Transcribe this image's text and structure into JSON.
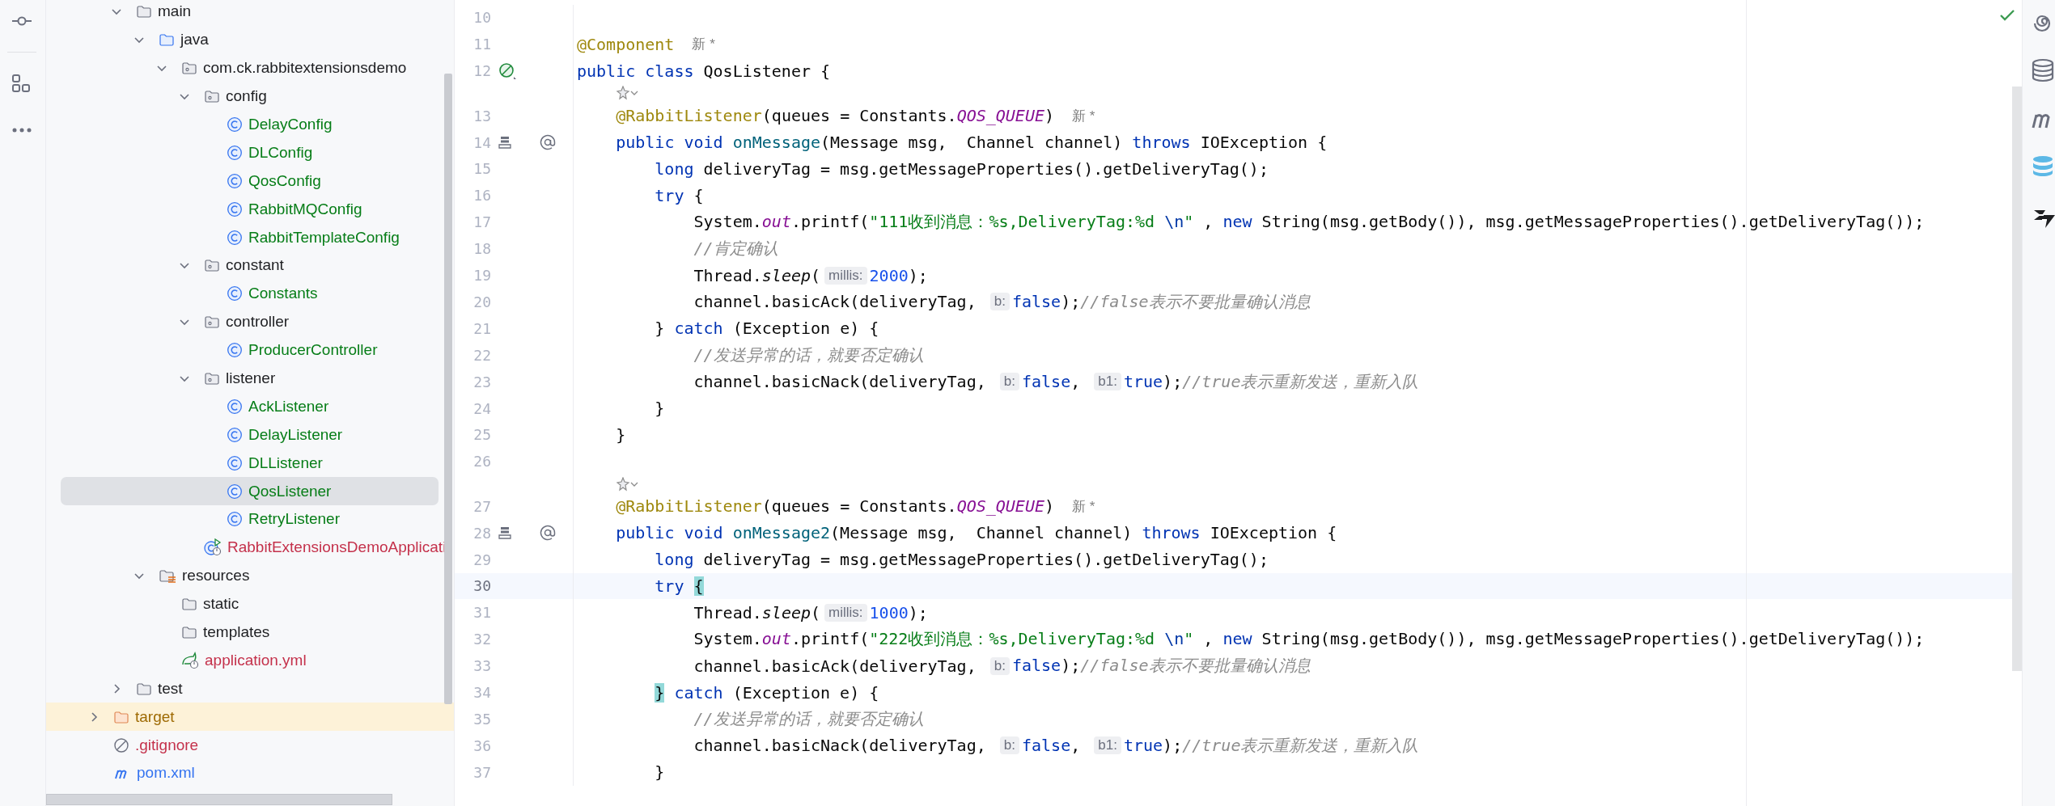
{
  "tree": {
    "items": [
      {
        "children": [
          {
            "label": "main",
            "kind": "folder",
            "expanded": true,
            "selected": false,
            "children": [
              {
                "label": "java",
                "kind": "source-folder",
                "expanded": true,
                "selected": false,
                "children": [
                  {
                    "label": "com.ck.rabbitextensionsdemo",
                    "kind": "package",
                    "expanded": true,
                    "selected": false,
                    "children": [
                      {
                        "label": "config",
                        "kind": "package",
                        "expanded": true,
                        "selected": false,
                        "children": [
                          {
                            "label": "DelayConfig",
                            "kind": "class",
                            "color": "#067d17",
                            "selected": false
                          },
                          {
                            "label": "DLConfig",
                            "kind": "class",
                            "color": "#067d17",
                            "selected": false
                          },
                          {
                            "label": "QosConfig",
                            "kind": "class",
                            "color": "#067d17",
                            "selected": false
                          },
                          {
                            "label": "RabbitMQConfig",
                            "kind": "class",
                            "color": "#067d17",
                            "selected": false
                          },
                          {
                            "label": "RabbitTemplateConfig",
                            "kind": "class",
                            "color": "#067d17",
                            "selected": false
                          }
                        ]
                      },
                      {
                        "label": "constant",
                        "kind": "package",
                        "expanded": true,
                        "selected": false,
                        "children": [
                          {
                            "label": "Constants",
                            "kind": "class",
                            "color": "#067d17",
                            "selected": false
                          }
                        ]
                      },
                      {
                        "label": "controller",
                        "kind": "package",
                        "expanded": true,
                        "selected": false,
                        "children": [
                          {
                            "label": "ProducerController",
                            "kind": "class",
                            "color": "#067d17",
                            "selected": false
                          }
                        ]
                      },
                      {
                        "label": "listener",
                        "kind": "package",
                        "expanded": true,
                        "selected": false,
                        "children": [
                          {
                            "label": "AckListener",
                            "kind": "class",
                            "color": "#067d17",
                            "selected": false
                          },
                          {
                            "label": "DelayListener",
                            "kind": "class",
                            "color": "#067d17",
                            "selected": false
                          },
                          {
                            "label": "DLListener",
                            "kind": "class",
                            "color": "#067d17",
                            "selected": false
                          },
                          {
                            "label": "QosListener",
                            "kind": "class",
                            "color": "#067d17",
                            "selected": true
                          },
                          {
                            "label": "RetryListener",
                            "kind": "class",
                            "color": "#067d17",
                            "selected": false
                          }
                        ]
                      },
                      {
                        "label": "RabbitExtensionsDemoApplicati",
                        "kind": "spring-class",
                        "color": "#c4314b",
                        "selected": false
                      }
                    ]
                  }
                ]
              },
              {
                "label": "resources",
                "kind": "resources-folder",
                "expanded": true,
                "selected": false,
                "children": [
                  {
                    "label": "static",
                    "kind": "folder",
                    "selected": false
                  },
                  {
                    "label": "templates",
                    "kind": "folder",
                    "selected": false
                  },
                  {
                    "label": "application.yml",
                    "kind": "spring-config",
                    "color": "#c4314b",
                    "selected": false
                  }
                ]
              }
            ]
          },
          {
            "label": "test",
            "kind": "folder",
            "expanded": false,
            "selected": false
          }
        ]
      },
      {
        "label": "target",
        "kind": "excluded-folder",
        "color": "#9e6a03",
        "expanded": false,
        "selected": false
      },
      {
        "label": ".gitignore",
        "kind": "ignore",
        "color": "#c4314b",
        "selected": false
      },
      {
        "label": "pom.xml",
        "kind": "maven",
        "color": "#3574f0",
        "selected": false
      }
    ]
  },
  "editor": {
    "lines": [
      {
        "kind": "code",
        "n": "10",
        "current": false
      },
      {
        "kind": "code",
        "n": "11",
        "current": false,
        "tokens": [
          {
            "kind": "ann",
            "text": "@Component"
          },
          {
            "kind": "author",
            "text": "新 *"
          }
        ]
      },
      {
        "kind": "code",
        "n": "12",
        "current": false,
        "gutter": [
          {
            "kind": "bean"
          }
        ],
        "tokens": [
          {
            "kind": "kw",
            "text": "public class"
          },
          {
            "kind": "p",
            "text": " QosListener {"
          }
        ]
      },
      {
        "kind": "hint"
      },
      {
        "kind": "code",
        "n": "13",
        "current": false,
        "tokens": [
          {
            "kind": "ann",
            "text": "    @RabbitListener"
          },
          {
            "kind": "p",
            "text": "(queues = Constants."
          },
          {
            "kind": "fld",
            "text": "QOS_QUEUE"
          },
          {
            "kind": "p",
            "text": ")"
          },
          {
            "kind": "author",
            "text": "新 *"
          }
        ]
      },
      {
        "kind": "code",
        "n": "14",
        "current": false,
        "gutter": [
          {
            "kind": "stack"
          },
          {
            "kind": "at"
          }
        ],
        "tokens": [
          {
            "kind": "kw",
            "text": "    public void"
          },
          {
            "kind": "mth",
            "text": " onMessage"
          },
          {
            "kind": "p",
            "text": "(Message msg,  Channel channel) "
          },
          {
            "kind": "kw",
            "text": "throws"
          },
          {
            "kind": "p",
            "text": " IOException {"
          }
        ]
      },
      {
        "kind": "code",
        "n": "15",
        "current": false,
        "tokens": [
          {
            "kind": "kw",
            "text": "        long"
          },
          {
            "kind": "p",
            "text": " deliveryTag = msg.getMessageProperties().getDeliveryTag();"
          }
        ]
      },
      {
        "kind": "code",
        "n": "16",
        "current": false,
        "tokens": [
          {
            "kind": "kw",
            "text": "        try"
          },
          {
            "kind": "p",
            "text": " {"
          }
        ]
      },
      {
        "kind": "code",
        "n": "17",
        "current": false,
        "tokens": [
          {
            "kind": "p",
            "text": "            System."
          },
          {
            "kind": "fld",
            "text": "out"
          },
          {
            "kind": "p",
            "text": ".printf("
          },
          {
            "kind": "str",
            "text": "\"111收到消息：%s,DeliveryTag:%d "
          },
          {
            "kind": "esc",
            "text": "\\n"
          },
          {
            "kind": "str",
            "text": "\""
          },
          {
            "kind": "p",
            "text": " , "
          },
          {
            "kind": "kw",
            "text": "new"
          },
          {
            "kind": "p",
            "text": " String(msg.getBody()), msg.getMessageProperties().getDeliveryTag());"
          }
        ]
      },
      {
        "kind": "code",
        "n": "18",
        "current": false,
        "tokens": [
          {
            "kind": "cmt",
            "text": "            //肯定确认"
          }
        ]
      },
      {
        "kind": "code",
        "n": "19",
        "current": false,
        "tokens": [
          {
            "kind": "p",
            "text": "            Thread."
          },
          {
            "kind": "ita",
            "text": "sleep"
          },
          {
            "kind": "p",
            "text": "("
          },
          {
            "kind": "hint",
            "text": "millis:"
          },
          {
            "kind": "num",
            "text": "2000"
          },
          {
            "kind": "p",
            "text": ");"
          }
        ]
      },
      {
        "kind": "code",
        "n": "20",
        "current": false,
        "tokens": [
          {
            "kind": "p",
            "text": "            channel.basicAck(deliveryTag, "
          },
          {
            "kind": "hint",
            "text": "b:"
          },
          {
            "kind": "kw",
            "text": "false"
          },
          {
            "kind": "p",
            "text": ");"
          },
          {
            "kind": "cmt",
            "text": "//false表示不要批量确认消息"
          }
        ]
      },
      {
        "kind": "code",
        "n": "21",
        "current": false,
        "tokens": [
          {
            "kind": "p",
            "text": "        } "
          },
          {
            "kind": "kw",
            "text": "catch"
          },
          {
            "kind": "p",
            "text": " (Exception e) {"
          }
        ]
      },
      {
        "kind": "code",
        "n": "22",
        "current": false,
        "tokens": [
          {
            "kind": "cmt",
            "text": "            //发送异常的话，就要否定确认"
          }
        ]
      },
      {
        "kind": "code",
        "n": "23",
        "current": false,
        "tokens": [
          {
            "kind": "p",
            "text": "            channel.basicNack(deliveryTag, "
          },
          {
            "kind": "hint",
            "text": "b:"
          },
          {
            "kind": "kw",
            "text": "false"
          },
          {
            "kind": "p",
            "text": ", "
          },
          {
            "kind": "hint",
            "text": "b1:"
          },
          {
            "kind": "kw",
            "text": "true"
          },
          {
            "kind": "p",
            "text": ");"
          },
          {
            "kind": "cmt",
            "text": "//true表示重新发送，重新入队"
          }
        ]
      },
      {
        "kind": "code",
        "n": "24",
        "current": false,
        "tokens": [
          {
            "kind": "p",
            "text": "        }"
          }
        ]
      },
      {
        "kind": "code",
        "n": "25",
        "current": false,
        "tokens": [
          {
            "kind": "p",
            "text": "    }"
          }
        ]
      },
      {
        "kind": "code",
        "n": "26",
        "current": false
      },
      {
        "kind": "hint"
      },
      {
        "kind": "code",
        "n": "27",
        "current": false,
        "tokens": [
          {
            "kind": "ann",
            "text": "    @RabbitListener"
          },
          {
            "kind": "p",
            "text": "(queues = Constants."
          },
          {
            "kind": "fld",
            "text": "QOS_QUEUE"
          },
          {
            "kind": "p",
            "text": ")"
          },
          {
            "kind": "author",
            "text": "新 *"
          }
        ]
      },
      {
        "kind": "code",
        "n": "28",
        "current": false,
        "gutter": [
          {
            "kind": "stack"
          },
          {
            "kind": "at"
          }
        ],
        "tokens": [
          {
            "kind": "kw",
            "text": "    public void"
          },
          {
            "kind": "mth",
            "text": " onMessage2"
          },
          {
            "kind": "p",
            "text": "(Message msg,  Channel channel) "
          },
          {
            "kind": "kw",
            "text": "throws"
          },
          {
            "kind": "p",
            "text": " IOException {"
          }
        ]
      },
      {
        "kind": "code",
        "n": "29",
        "current": false,
        "tokens": [
          {
            "kind": "kw",
            "text": "        long"
          },
          {
            "kind": "p",
            "text": " deliveryTag = msg.getMessageProperties().getDeliveryTag();"
          }
        ]
      },
      {
        "kind": "code",
        "n": "30",
        "current": true,
        "tokens": [
          {
            "kind": "kw",
            "text": "        try"
          },
          {
            "kind": "brace",
            "text": " {"
          }
        ]
      },
      {
        "kind": "code",
        "n": "31",
        "current": false,
        "tokens": [
          {
            "kind": "p",
            "text": "            Thread."
          },
          {
            "kind": "ita",
            "text": "sleep"
          },
          {
            "kind": "p",
            "text": "("
          },
          {
            "kind": "hint",
            "text": "millis:"
          },
          {
            "kind": "num",
            "text": "1000"
          },
          {
            "kind": "p",
            "text": ");"
          }
        ]
      },
      {
        "kind": "code",
        "n": "32",
        "current": false,
        "tokens": [
          {
            "kind": "p",
            "text": "            System."
          },
          {
            "kind": "fld",
            "text": "out"
          },
          {
            "kind": "p",
            "text": ".printf("
          },
          {
            "kind": "str",
            "text": "\"222收到消息：%s,DeliveryTag:%d "
          },
          {
            "kind": "esc",
            "text": "\\n"
          },
          {
            "kind": "str",
            "text": "\""
          },
          {
            "kind": "p",
            "text": " , "
          },
          {
            "kind": "kw",
            "text": "new"
          },
          {
            "kind": "p",
            "text": " String(msg.getBody()), msg.getMessageProperties().getDeliveryTag());"
          }
        ]
      },
      {
        "kind": "code",
        "n": "33",
        "current": false,
        "tokens": [
          {
            "kind": "p",
            "text": "            channel.basicAck(deliveryTag, "
          },
          {
            "kind": "hint",
            "text": "b:"
          },
          {
            "kind": "kw",
            "text": "false"
          },
          {
            "kind": "p",
            "text": ");"
          },
          {
            "kind": "cmt",
            "text": "//false表示不要批量确认消息"
          }
        ]
      },
      {
        "kind": "code",
        "n": "34",
        "current": false,
        "tokens": [
          {
            "kind": "brace",
            "text": "        }"
          },
          {
            "kind": "kw",
            "text": " catch"
          },
          {
            "kind": "p",
            "text": " (Exception e) {"
          }
        ]
      },
      {
        "kind": "code",
        "n": "35",
        "current": false,
        "tokens": [
          {
            "kind": "cmt",
            "text": "            //发送异常的话，就要否定确认"
          }
        ]
      },
      {
        "kind": "code",
        "n": "36",
        "current": false,
        "tokens": [
          {
            "kind": "p",
            "text": "            channel.basicNack(deliveryTag, "
          },
          {
            "kind": "hint",
            "text": "b:"
          },
          {
            "kind": "kw",
            "text": "false"
          },
          {
            "kind": "p",
            "text": ", "
          },
          {
            "kind": "hint",
            "text": "b1:"
          },
          {
            "kind": "kw",
            "text": "true"
          },
          {
            "kind": "p",
            "text": ");"
          },
          {
            "kind": "cmt",
            "text": "//true表示重新发送，重新入队"
          }
        ]
      },
      {
        "kind": "code",
        "n": "37",
        "current": false,
        "tokens": [
          {
            "kind": "p",
            "text": "        }"
          }
        ]
      }
    ]
  }
}
